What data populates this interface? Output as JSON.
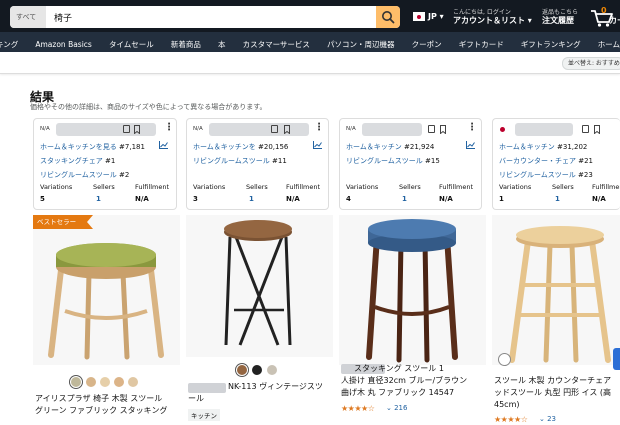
{
  "header": {
    "search_category": "すべて",
    "search_value": "椅子",
    "lang": "JP",
    "account_line1": "こんにちは, ログイン",
    "account_line2": "アカウント＆リスト",
    "returns_line1": "返品もこちら",
    "returns_line2": "注文履歴",
    "cart_count": "0",
    "cart_label": "カート"
  },
  "nav": {
    "items": [
      "キング",
      "Amazon Basics",
      "タイムセール",
      "新着商品",
      "本",
      "カスタマーサービス",
      "パソコン・周辺機器",
      "クーポン",
      "ギフトカード",
      "ギフトランキング",
      "ホーム&キッチン"
    ]
  },
  "subnav": {
    "sort_label": "並べ替え: おすすめ"
  },
  "results": {
    "title": "結果",
    "subtitle": "価格やその他の詳細は、商品のサイズや色によって異なる場合があります。"
  },
  "info_cards": [
    {
      "na": "N/A",
      "rows": [
        {
          "text": "ホーム＆キッチンを見る",
          "rank": "#7,181"
        },
        {
          "text": "スタッキングチェア",
          "rank": "#1"
        },
        {
          "text": "リビングルームスツール",
          "rank": "#2"
        }
      ],
      "variations": "5",
      "sellers": "1",
      "fulfillment": "N/A"
    },
    {
      "na": "N/A",
      "rows": [
        {
          "text": "ホーム＆キッチンを",
          "rank": "#20,156"
        },
        {
          "text": "リビングルームスツール",
          "rank": "#11"
        }
      ],
      "variations": "3",
      "sellers": "1",
      "fulfillment": "N/A"
    },
    {
      "na": "N/A",
      "rows": [
        {
          "text": "ホーム＆キッチン",
          "rank": "#21,924"
        },
        {
          "text": "リビングルームスツール",
          "rank": "#15"
        }
      ],
      "variations": "4",
      "sellers": "1",
      "fulfillment": "N/A"
    },
    {
      "na": "",
      "rows": [
        {
          "text": "ホーム＆キッチン",
          "rank": "#31,202"
        },
        {
          "text": "バーカウンター・チェア",
          "rank": "#21"
        },
        {
          "text": "リビングルームスツール",
          "rank": "#23"
        }
      ],
      "variations": "1",
      "sellers": "1",
      "fulfillment": "N/A"
    }
  ],
  "stat_labels": {
    "variations": "Variations",
    "sellers": "Sellers",
    "fulfillment": "Fulfillment"
  },
  "products": [
    {
      "badge": "ベストセラー",
      "title_line1": "アイリスプラザ 椅子 木製 スツール",
      "title_line2": "グリーン ファブリック スタッキング"
    },
    {
      "title_line1": "NK-113 ヴィンテージスツ",
      "title_line2": "ール",
      "tag": "キッチン"
    },
    {
      "title_line1": "スタッキング スツール 1",
      "title_line2": "人掛け 直径32cm ブルー/ブラウン",
      "title_line3": "曲げ木 丸 ファブリック 14547",
      "reviews": "216"
    },
    {
      "title_line1": "スツール 木製 カウンターチェア",
      "title_line2": "ッドスツール 丸型 円形 イス (高",
      "title_line3": "45cm)",
      "reviews": "23"
    }
  ],
  "colors": {
    "header_bg": "#131921",
    "nav_bg": "#232f3e",
    "search_button": "#febd69",
    "link": "#2162a1",
    "badge": "#e47911",
    "star": "#de7921"
  }
}
